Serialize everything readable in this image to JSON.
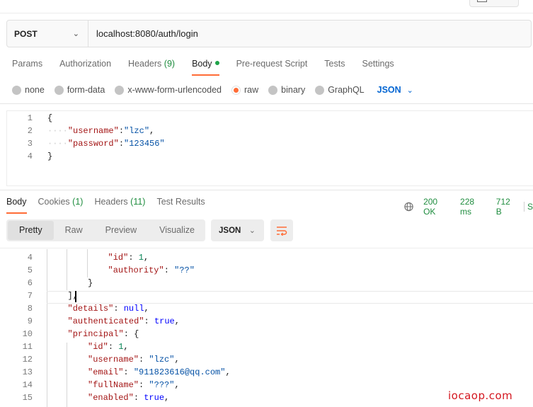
{
  "request": {
    "method": "POST",
    "url": "localhost:8080/auth/login",
    "tabs": [
      {
        "label": "Params",
        "count": ""
      },
      {
        "label": "Authorization",
        "count": ""
      },
      {
        "label": "Headers",
        "count": "(9)"
      },
      {
        "label": "Body",
        "count": ""
      },
      {
        "label": "Pre-request Script",
        "count": ""
      },
      {
        "label": "Tests",
        "count": ""
      },
      {
        "label": "Settings",
        "count": ""
      }
    ],
    "active_tab": "Body",
    "body_types": [
      "none",
      "form-data",
      "x-www-form-urlencoded",
      "raw",
      "binary",
      "GraphQL"
    ],
    "selected_body_type": "raw",
    "language": "JSON",
    "body_lines": [
      {
        "n": "1",
        "text": "{"
      },
      {
        "n": "2",
        "key": "\"username\"",
        "value": "\"lzc\"",
        "trail": ","
      },
      {
        "n": "3",
        "key": "\"password\"",
        "value": "\"123456\"",
        "trail": ""
      },
      {
        "n": "4",
        "text": "}"
      }
    ]
  },
  "response": {
    "tabs": [
      {
        "label": "Body",
        "count": ""
      },
      {
        "label": "Cookies",
        "count": "(1)"
      },
      {
        "label": "Headers",
        "count": "(11)"
      },
      {
        "label": "Test Results",
        "count": ""
      }
    ],
    "active_tab": "Body",
    "status": "200 OK",
    "time": "228 ms",
    "size": "712 B",
    "cut_off": "S",
    "view_modes": [
      "Pretty",
      "Raw",
      "Preview",
      "Visualize"
    ],
    "active_view": "Pretty",
    "format": "JSON",
    "lines": [
      {
        "n": "4",
        "parts": [
          [
            "key",
            "\"id\""
          ],
          [
            "p",
            ": "
          ],
          [
            "num",
            "1"
          ],
          [
            "p",
            ","
          ]
        ]
      },
      {
        "n": "5",
        "parts": [
          [
            "key",
            "\"authority\""
          ],
          [
            "p",
            ": "
          ],
          [
            "str",
            "\"??\""
          ]
        ]
      },
      {
        "n": "6",
        "parts": [
          [
            "p",
            "}"
          ]
        ]
      },
      {
        "n": "7",
        "parts": [
          [
            "p",
            "],"
          ]
        ]
      },
      {
        "n": "8",
        "parts": [
          [
            "key",
            "\"details\""
          ],
          [
            "p",
            ": "
          ],
          [
            "kw",
            "null"
          ],
          [
            "p",
            ","
          ]
        ]
      },
      {
        "n": "9",
        "parts": [
          [
            "key",
            "\"authenticated\""
          ],
          [
            "p",
            ": "
          ],
          [
            "kw",
            "true"
          ],
          [
            "p",
            ","
          ]
        ]
      },
      {
        "n": "10",
        "parts": [
          [
            "key",
            "\"principal\""
          ],
          [
            "p",
            ": {"
          ]
        ]
      },
      {
        "n": "11",
        "parts": [
          [
            "key",
            "\"id\""
          ],
          [
            "p",
            ": "
          ],
          [
            "num",
            "1"
          ],
          [
            "p",
            ","
          ]
        ]
      },
      {
        "n": "12",
        "parts": [
          [
            "key",
            "\"username\""
          ],
          [
            "p",
            ": "
          ],
          [
            "str",
            "\"lzc\""
          ],
          [
            "p",
            ","
          ]
        ]
      },
      {
        "n": "13",
        "parts": [
          [
            "key",
            "\"email\""
          ],
          [
            "p",
            ": "
          ],
          [
            "str",
            "\"911823616@qq.com\""
          ],
          [
            "p",
            ","
          ]
        ]
      },
      {
        "n": "14",
        "parts": [
          [
            "key",
            "\"fullName\""
          ],
          [
            "p",
            ": "
          ],
          [
            "str",
            "\"???\""
          ],
          [
            "p",
            ","
          ]
        ]
      },
      {
        "n": "15",
        "parts": [
          [
            "key",
            "\"enabled\""
          ],
          [
            "p",
            ": "
          ],
          [
            "kw",
            "true"
          ],
          [
            "p",
            ","
          ]
        ]
      }
    ]
  },
  "watermark": "iocaop.com",
  "colors": {
    "accent": "#ff6c37",
    "success": "#1f8d3f",
    "link": "#0265d2",
    "watermark": "#d4161f"
  }
}
